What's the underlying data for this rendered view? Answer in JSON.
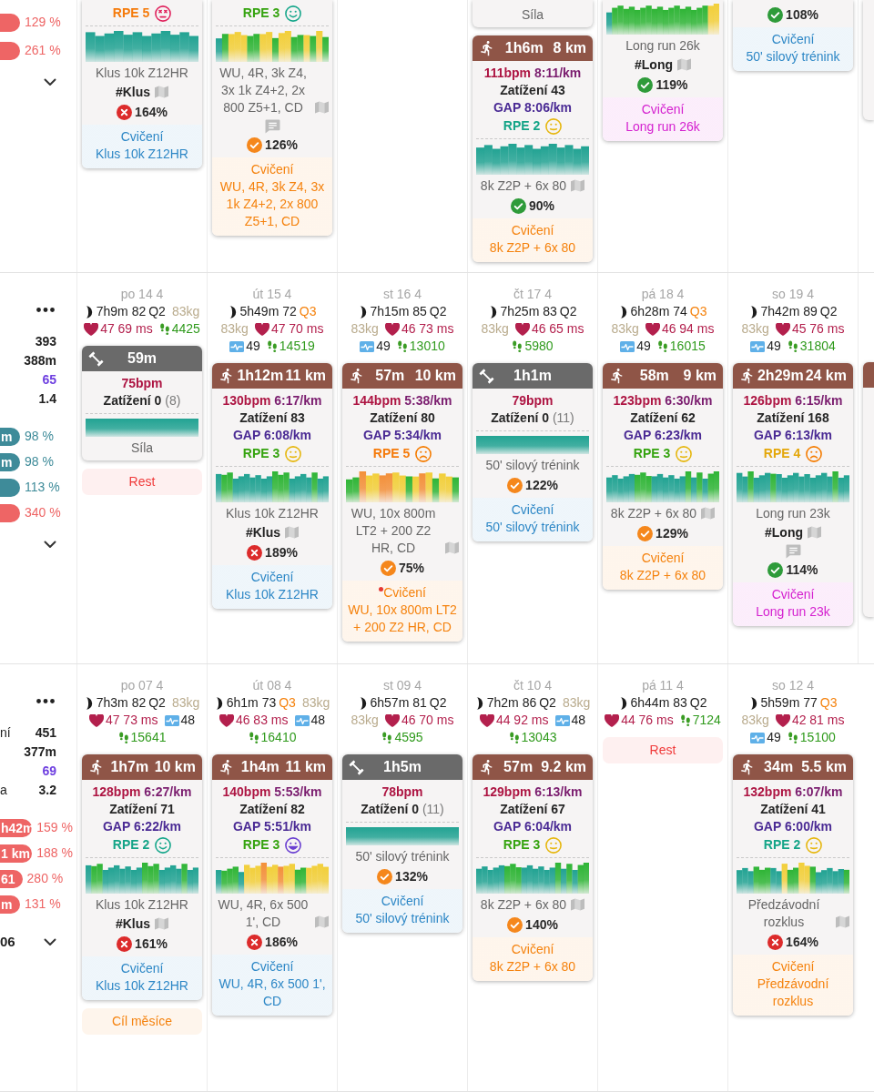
{
  "weeks": [
    {
      "summary": {
        "menu": false,
        "pills": [
          {
            "value": "129 %",
            "color": "#ee6565"
          },
          {
            "value": "261 %",
            "color": "#ee6565"
          }
        ]
      },
      "days": [
        {
          "empty_day_before": false,
          "items": [
            {
              "kind": "activity",
              "rpe": {
                "text": "RPE 5",
                "color": "#f57a0a",
                "kind": "bad"
              },
              "chart": {
                "kind": "easy"
              },
              "name": "Klus 10k Z12HR",
              "tag": "#Klus",
              "map": true,
              "comment": false,
              "compliance": {
                "kind": "bad",
                "text": "164%"
              },
              "plan": {
                "label": "Cvičení",
                "name": "Klus 10k Z12HR",
                "color": "#2d87c6",
                "alert": false
              }
            }
          ]
        },
        {
          "empty_day_before": false,
          "items": [
            {
              "kind": "activity",
              "rpe": {
                "text": "RPE 3",
                "color": "#35a30f",
                "kind": "good"
              },
              "chart": {
                "kind": "intervals"
              },
              "name": "WU, 4R, 3k Z4, 3x 1k Z4+2, 2x 800 Z5+1, CD",
              "map": true,
              "comment": true,
              "compliance": {
                "kind": "warn",
                "text": "126%"
              },
              "plan": {
                "label": "Cvičení",
                "name": "WU, 4R, 3k Z4, 3x 1k Z4+2, 2x 800 Z5+1, CD",
                "color": "#f5820d",
                "alert": false
              }
            }
          ]
        },
        {
          "empty_day_before": true,
          "items": [
            {
              "kind": "activity",
              "name": "Síla",
              "map": false,
              "comment": false
            },
            {
              "kind": "activity",
              "sport": {
                "kind": "run"
              },
              "duration": "1h6m",
              "distance": "8 km",
              "bpm": "111bpm",
              "pace": "8:11/km",
              "load": "Zatížení 43",
              "gap": "GAP 8:06/km",
              "rpe": {
                "text": "RPE 2",
                "color": "#14a487",
                "kind": "normal"
              },
              "chart": {
                "kind": "steady"
              },
              "name": "8k Z2P + 6x 80",
              "map": true,
              "comment": false,
              "compliance": {
                "kind": "good",
                "text": "90%"
              },
              "plan": {
                "label": "Cvičení",
                "name": "8k Z2P + 6x 80",
                "color": "#f5820d",
                "alert": false
              }
            }
          ]
        },
        {
          "empty_day_before": false,
          "items": [
            {
              "kind": "activity",
              "chart": {
                "kind": "green"
              },
              "name": "Long run 26k",
              "tag": "#Long",
              "map": true,
              "comment": false,
              "compliance": {
                "kind": "good",
                "text": "119%"
              },
              "plan": {
                "label": "Cvičení",
                "name": "Long run 26k",
                "color": "#d41fcf",
                "alert": false
              }
            }
          ]
        },
        {
          "empty_day_before": false,
          "items": [
            {
              "kind": "activity",
              "map": false,
              "comment": false,
              "compliance": {
                "kind": "good",
                "text": "108%"
              },
              "plan": {
                "label": "Cvičení",
                "name": "50' silový trénink",
                "color": "#2d87c6",
                "alert": false
              }
            }
          ]
        },
        {
          "empty_day_before": false,
          "items": [
            {
              "kind": "edge"
            }
          ]
        }
      ]
    },
    {
      "summary": {
        "menu": true,
        "stats": [
          {
            "value": "393",
            "color": "#222222"
          },
          {
            "value": "388m",
            "color": "#222222"
          },
          {
            "value": "65",
            "color": "#6e3fe0"
          },
          {
            "value": "1.4",
            "color": "#222222"
          }
        ],
        "pills": [
          {
            "label": "m",
            "value": "98 %",
            "color": "#3e8b99"
          },
          {
            "label": "m",
            "value": "98 %",
            "color": "#3e8b99"
          },
          {
            "value": "113 %",
            "color": "#3e8b99"
          },
          {
            "value": "340 %",
            "color": "#ee6565"
          }
        ]
      },
      "days": [
        {
          "date": "po 14 4",
          "wellness": [
            [
              {
                "kind": "sleep",
                "text": "7h9m 82",
                "quality": "Q2",
                "poor": false
              },
              {
                "kind": "weight",
                "text": "83kg"
              }
            ],
            [
              {
                "kind": "hr",
                "text": "47 69 ms"
              },
              {
                "kind": "steps",
                "text": "4425"
              }
            ]
          ],
          "items": [
            {
              "kind": "activity",
              "sport": {
                "kind": "strength"
              },
              "duration": "59m",
              "bpm": "75bpm",
              "load": "Zatížení 0",
              "load_extra": "(8)",
              "chart": {
                "kind": "flat"
              },
              "name": "Síla",
              "map": false,
              "comment": false
            },
            {
              "kind": "note",
              "text": "Rest",
              "color": "#f03a3a"
            }
          ]
        },
        {
          "date": "út 15 4",
          "wellness": [
            [
              {
                "kind": "sleep",
                "text": "5h49m 72",
                "quality": "Q3",
                "poor": true
              }
            ],
            [
              {
                "kind": "weight",
                "text": "83kg"
              },
              {
                "kind": "hr",
                "text": "47 70 ms"
              }
            ],
            [
              {
                "kind": "pulse",
                "text": "49"
              },
              {
                "kind": "steps",
                "text": "14519"
              }
            ]
          ],
          "items": [
            {
              "kind": "activity",
              "sport": {
                "kind": "run"
              },
              "duration": "1h12m",
              "distance": "11 km",
              "bpm": "130bpm",
              "pace": "6:17/km",
              "load": "Zatížení 83",
              "gap": "GAP 6:08/km",
              "rpe": {
                "text": "RPE 3",
                "color": "#35a30f",
                "kind": "normal"
              },
              "chart": {
                "kind": "mixed"
              },
              "name": "Klus 10k Z12HR",
              "tag": "#Klus",
              "map": true,
              "comment": false,
              "compliance": {
                "kind": "bad",
                "text": "189%"
              },
              "plan": {
                "label": "Cvičení",
                "name": "Klus 10k Z12HR",
                "color": "#2d87c6",
                "alert": false
              }
            }
          ]
        },
        {
          "date": "st 16 4",
          "wellness": [
            [
              {
                "kind": "sleep",
                "text": "7h15m 85",
                "quality": "Q2",
                "poor": false
              }
            ],
            [
              {
                "kind": "weight",
                "text": "83kg"
              },
              {
                "kind": "hr",
                "text": "46 73 ms"
              }
            ],
            [
              {
                "kind": "pulse",
                "text": "49"
              },
              {
                "kind": "steps",
                "text": "13010"
              }
            ]
          ],
          "items": [
            {
              "kind": "activity",
              "sport": {
                "kind": "run"
              },
              "duration": "57m",
              "distance": "10 km",
              "bpm": "144bpm",
              "pace": "5:38/km",
              "load": "Zatížení 80",
              "gap": "GAP 5:34/km",
              "rpe": {
                "text": "RPE 5",
                "color": "#f57a0a",
                "kind": "poor"
              },
              "chart": {
                "kind": "hard"
              },
              "name": "WU, 10x 800m LT2 + 200 Z2 HR, CD",
              "map": true,
              "comment": false,
              "compliance": {
                "kind": "warn",
                "text": "75%"
              },
              "plan": {
                "label": "Cvičení",
                "name": "WU, 10x 800m LT2 + 200 Z2 HR, CD",
                "color": "#f5820d",
                "alert": true
              }
            }
          ]
        },
        {
          "date": "čt 17 4",
          "wellness": [
            [
              {
                "kind": "sleep",
                "text": "7h25m 83",
                "quality": "Q2",
                "poor": false
              }
            ],
            [
              {
                "kind": "weight",
                "text": "83kg"
              },
              {
                "kind": "hr",
                "text": "46 65 ms"
              }
            ],
            [
              {
                "kind": "steps",
                "text": "5980"
              }
            ]
          ],
          "items": [
            {
              "kind": "activity",
              "sport": {
                "kind": "strength"
              },
              "duration": "1h1m",
              "bpm": "79bpm",
              "load": "Zatížení 0",
              "load_extra": "(11)",
              "chart": {
                "kind": "flat"
              },
              "name": "50' silový trénink",
              "map": false,
              "comment": false,
              "compliance": {
                "kind": "warn",
                "text": "122%"
              },
              "plan": {
                "label": "Cvičení",
                "name": "50' silový trénink",
                "color": "#2d87c6",
                "alert": false
              }
            }
          ]
        },
        {
          "date": "pá 18 4",
          "wellness": [
            [
              {
                "kind": "sleep",
                "text": "6h28m 74",
                "quality": "Q3",
                "poor": true
              }
            ],
            [
              {
                "kind": "weight",
                "text": "83kg"
              },
              {
                "kind": "hr",
                "text": "46 94 ms"
              }
            ],
            [
              {
                "kind": "pulse",
                "text": "49"
              },
              {
                "kind": "steps",
                "text": "16015"
              }
            ]
          ],
          "items": [
            {
              "kind": "activity",
              "sport": {
                "kind": "run"
              },
              "duration": "58m",
              "distance": "9 km",
              "bpm": "123bpm",
              "pace": "6:30/km",
              "load": "Zatížení 62",
              "gap": "GAP 6:23/km",
              "rpe": {
                "text": "RPE 3",
                "color": "#35a30f",
                "kind": "normal"
              },
              "chart": {
                "kind": "tempo"
              },
              "name": "8k Z2P + 6x 80",
              "map": true,
              "comment": false,
              "compliance": {
                "kind": "warn",
                "text": "129%"
              },
              "plan": {
                "label": "Cvičení",
                "name": "8k Z2P + 6x 80",
                "color": "#f5820d",
                "alert": false
              }
            }
          ]
        },
        {
          "date": "so 19 4",
          "wellness": [
            [
              {
                "kind": "sleep",
                "text": "7h42m 89",
                "quality": "Q2",
                "poor": false
              }
            ],
            [
              {
                "kind": "weight",
                "text": "83kg"
              },
              {
                "kind": "hr",
                "text": "45 76 ms"
              }
            ],
            [
              {
                "kind": "pulse",
                "text": "49"
              },
              {
                "kind": "steps",
                "text": "31804"
              }
            ]
          ],
          "items": [
            {
              "kind": "activity",
              "sport": {
                "kind": "run"
              },
              "duration": "2h29m",
              "distance": "24 km",
              "bpm": "126bpm",
              "pace": "6:15/km",
              "load": "Zatížení 168",
              "gap": "GAP 6:13/km",
              "rpe": {
                "text": "RPE 4",
                "color": "#e4a70a",
                "kind": "poor"
              },
              "chart": {
                "kind": "long"
              },
              "name": "Long run 23k",
              "tag": "#Long",
              "map": true,
              "comment": true,
              "compliance": {
                "kind": "good",
                "text": "114%"
              },
              "plan": {
                "label": "Cvičení",
                "name": "Long run 23k",
                "color": "#d41fcf",
                "alert": false
              }
            }
          ]
        },
        {
          "items": [
            {
              "kind": "edge",
              "sport": {
                "kind": "run"
              }
            }
          ]
        }
      ]
    },
    {
      "summary": {
        "menu": true,
        "stats": [
          {
            "label": "ní",
            "value": "451",
            "color": "#222222"
          },
          {
            "value": "377m",
            "color": "#222222"
          },
          {
            "value": "69",
            "color": "#6e3fe0"
          },
          {
            "label": "a",
            "value": "3.2",
            "color": "#222222"
          }
        ],
        "pills": [
          {
            "label": "h42m",
            "value": "159 %",
            "color": "#ee6565"
          },
          {
            "label": "1 km",
            "value": "188 %",
            "color": "#ee6565"
          },
          {
            "label": "61",
            "value": "280 %",
            "color": "#ee6565"
          },
          {
            "label": "m",
            "value": "131 %",
            "color": "#ee6565"
          }
        ],
        "footer": "06"
      },
      "days": [
        {
          "date": "po 07 4",
          "wellness": [
            [
              {
                "kind": "sleep",
                "text": "7h3m 82",
                "quality": "Q2",
                "poor": false
              },
              {
                "kind": "weight",
                "text": "83kg"
              }
            ],
            [
              {
                "kind": "hr",
                "text": "47 73 ms"
              },
              {
                "kind": "pulse",
                "text": "48"
              }
            ],
            [
              {
                "kind": "steps",
                "text": "15641"
              }
            ]
          ],
          "items": [
            {
              "kind": "activity",
              "sport": {
                "kind": "run"
              },
              "duration": "1h7m",
              "distance": "10 km",
              "bpm": "128bpm",
              "pace": "6:27/km",
              "load": "Zatížení 71",
              "gap": "GAP 6:22/km",
              "rpe": {
                "text": "RPE 2",
                "color": "#14a487",
                "kind": "good"
              },
              "chart": {
                "kind": "mixed"
              },
              "name": "Klus 10k Z12HR",
              "tag": "#Klus",
              "map": true,
              "comment": false,
              "compliance": {
                "kind": "bad",
                "text": "161%"
              },
              "plan": {
                "label": "Cvičení",
                "name": "Klus 10k Z12HR",
                "color": "#2d87c6",
                "alert": false
              }
            },
            {
              "kind": "note",
              "text": "Cíl měsíce",
              "color": "#f5820d"
            }
          ]
        },
        {
          "date": "út 08 4",
          "wellness": [
            [
              {
                "kind": "sleep",
                "text": "6h1m 73",
                "quality": "Q3",
                "poor": true
              },
              {
                "kind": "weight",
                "text": "83kg"
              }
            ],
            [
              {
                "kind": "hr",
                "text": "46 83 ms"
              },
              {
                "kind": "pulse",
                "text": "48"
              }
            ],
            [
              {
                "kind": "steps",
                "text": "16410"
              }
            ]
          ],
          "items": [
            {
              "kind": "activity",
              "sport": {
                "kind": "run"
              },
              "duration": "1h4m",
              "distance": "11 km",
              "bpm": "140bpm",
              "pace": "5:53/km",
              "load": "Zatížení 82",
              "gap": "GAP 5:51/km",
              "rpe": {
                "text": "RPE 3",
                "color": "#35a30f",
                "kind": "great"
              },
              "chart": {
                "kind": "build"
              },
              "name": "WU, 4R, 6x 500 1', CD",
              "map": true,
              "comment": false,
              "compliance": {
                "kind": "bad",
                "text": "186%"
              },
              "plan": {
                "label": "Cvičení",
                "name": "WU, 4R, 6x 500 1', CD",
                "color": "#2d87c6",
                "alert": false
              }
            }
          ]
        },
        {
          "date": "st 09 4",
          "wellness": [
            [
              {
                "kind": "sleep",
                "text": "6h57m 81",
                "quality": "Q2",
                "poor": false
              }
            ],
            [
              {
                "kind": "weight",
                "text": "83kg"
              },
              {
                "kind": "hr",
                "text": "46 70 ms"
              }
            ],
            [
              {
                "kind": "steps",
                "text": "4595"
              }
            ]
          ],
          "items": [
            {
              "kind": "activity",
              "sport": {
                "kind": "strength"
              },
              "duration": "1h5m",
              "bpm": "78bpm",
              "load": "Zatížení 0",
              "load_extra": "(11)",
              "chart": {
                "kind": "flat"
              },
              "name": "50' silový trénink",
              "map": false,
              "comment": false,
              "compliance": {
                "kind": "warn",
                "text": "132%"
              },
              "plan": {
                "label": "Cvičení",
                "name": "50' silový trénink",
                "color": "#2d87c6",
                "alert": false
              }
            }
          ]
        },
        {
          "date": "čt 10 4",
          "wellness": [
            [
              {
                "kind": "sleep",
                "text": "7h2m 86",
                "quality": "Q2",
                "poor": false
              },
              {
                "kind": "weight",
                "text": "83kg"
              }
            ],
            [
              {
                "kind": "hr",
                "text": "44 92 ms"
              },
              {
                "kind": "pulse",
                "text": "48"
              }
            ],
            [
              {
                "kind": "steps",
                "text": "13043"
              }
            ]
          ],
          "items": [
            {
              "kind": "activity",
              "sport": {
                "kind": "run"
              },
              "duration": "57m",
              "distance": "9.2 km",
              "bpm": "129bpm",
              "pace": "6:13/km",
              "load": "Zatížení 67",
              "gap": "GAP 6:04/km",
              "rpe": {
                "text": "RPE 3",
                "color": "#35a30f",
                "kind": "normal"
              },
              "chart": {
                "kind": "tempo"
              },
              "name": "8k Z2P + 6x 80",
              "map": true,
              "comment": false,
              "compliance": {
                "kind": "warn",
                "text": "140%"
              },
              "plan": {
                "label": "Cvičení",
                "name": "8k Z2P + 6x 80",
                "color": "#f5820d",
                "alert": false
              }
            }
          ]
        },
        {
          "date": "pá 11 4",
          "wellness": [
            [
              {
                "kind": "sleep",
                "text": "6h44m 83",
                "quality": "Q2",
                "poor": false
              }
            ],
            [
              {
                "kind": "hr",
                "text": "44 76 ms"
              },
              {
                "kind": "steps",
                "text": "7124"
              }
            ]
          ],
          "items": [
            {
              "kind": "note",
              "text": "Rest",
              "color": "#f03a3a"
            }
          ]
        },
        {
          "date": "so 12 4",
          "wellness": [
            [
              {
                "kind": "sleep",
                "text": "5h59m 77",
                "quality": "Q3",
                "poor": true
              }
            ],
            [
              {
                "kind": "weight",
                "text": "83kg"
              },
              {
                "kind": "hr",
                "text": "42 81 ms"
              }
            ],
            [
              {
                "kind": "pulse",
                "text": "49"
              },
              {
                "kind": "steps",
                "text": "15100"
              }
            ]
          ],
          "items": [
            {
              "kind": "activity",
              "sport": {
                "kind": "run"
              },
              "duration": "34m",
              "distance": "5.5 km",
              "bpm": "132bpm",
              "pace": "6:07/km",
              "load": "Zatížení 41",
              "gap": "GAP 6:00/km",
              "rpe": {
                "text": "RPE 2",
                "color": "#14a487",
                "kind": "normal"
              },
              "chart": {
                "kind": "race"
              },
              "name": "Předzávodní rozklus",
              "map": true,
              "comment": false,
              "compliance": {
                "kind": "bad",
                "text": "164%"
              },
              "plan": {
                "label": "Cvičení",
                "name": "Předzávodní rozklus",
                "color": "#f5820d",
                "alert": false
              }
            }
          ]
        }
      ]
    }
  ]
}
